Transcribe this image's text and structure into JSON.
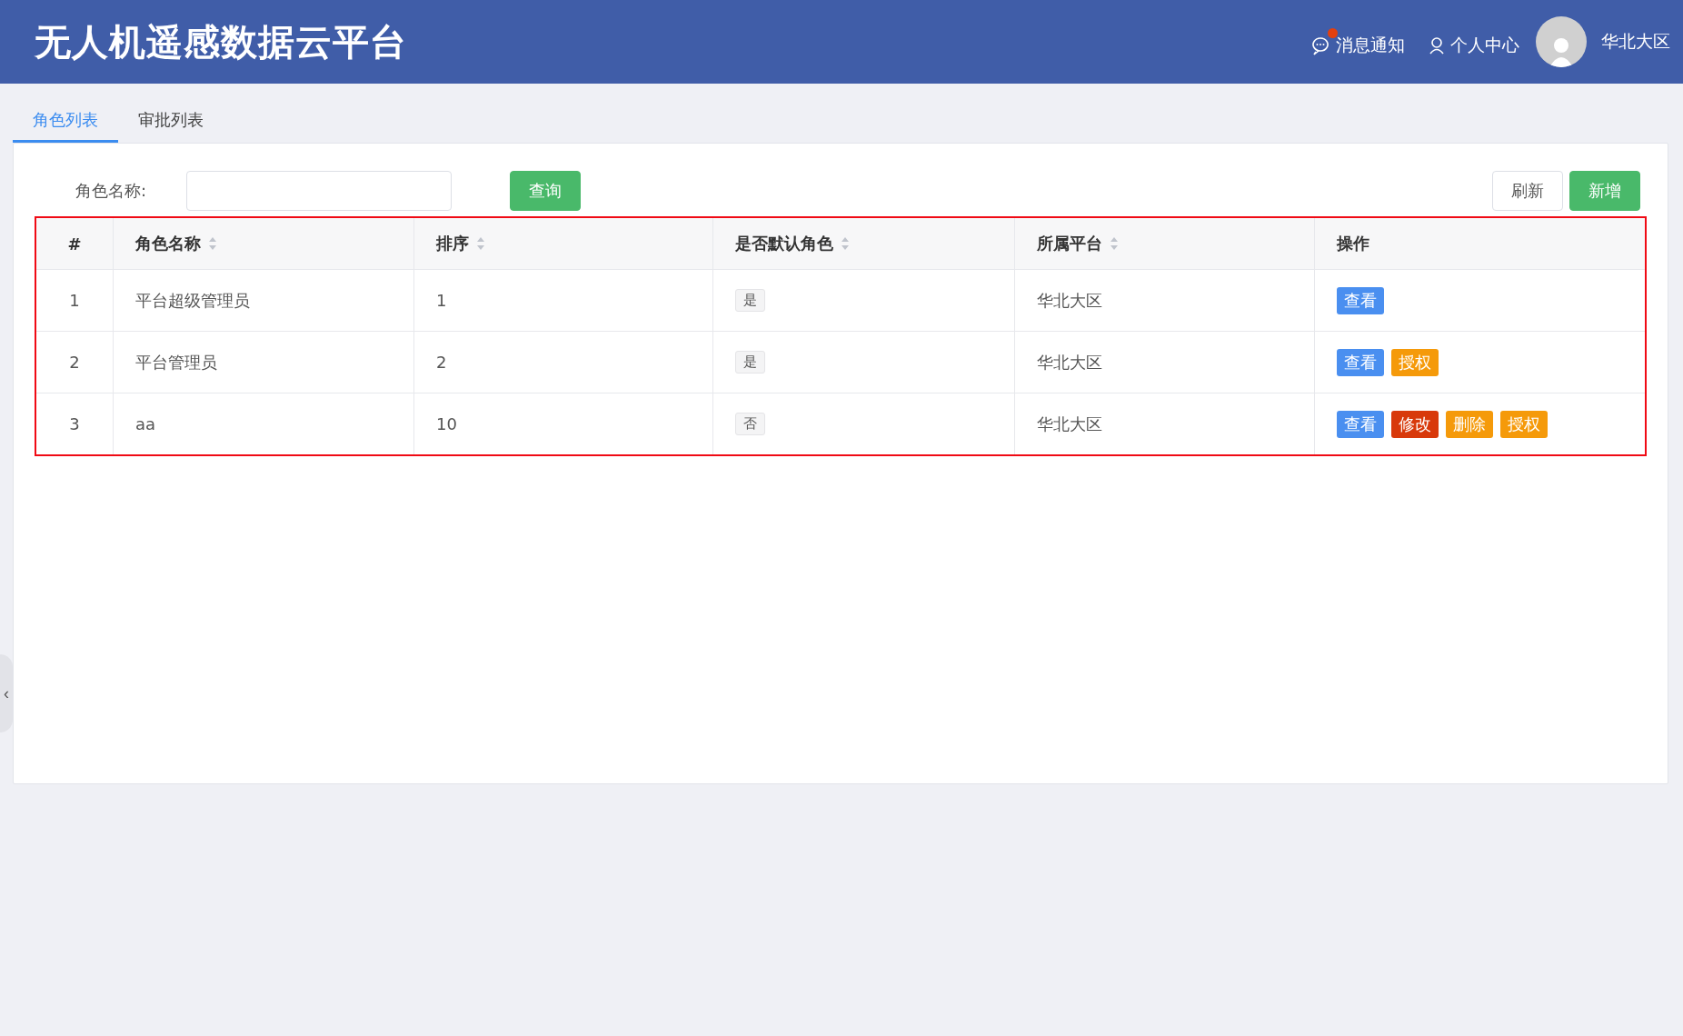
{
  "header": {
    "title": "无人机遥感数据云平台",
    "notifications": {
      "label": "消息通知",
      "unread": true
    },
    "profile": {
      "label": "个人中心"
    },
    "region": "华北大区"
  },
  "tabs": [
    {
      "label": "角色列表",
      "selected": true
    },
    {
      "label": "审批列表",
      "selected": false
    }
  ],
  "filter": {
    "label": "角色名称:",
    "search_button": "查询"
  },
  "toolbar": {
    "refresh": "刷新",
    "add": "新增"
  },
  "table": {
    "columns": [
      {
        "label": "#",
        "sortable": false
      },
      {
        "label": "角色名称",
        "sortable": true
      },
      {
        "label": "排序",
        "sortable": true
      },
      {
        "label": "是否默认角色",
        "sortable": true
      },
      {
        "label": "所属平台",
        "sortable": true
      },
      {
        "label": "操作",
        "sortable": false
      }
    ],
    "rows": [
      {
        "index": "1",
        "name": "平台超级管理员",
        "order": "1",
        "default": "是",
        "platform": "华北大区",
        "actions": [
          {
            "kind": "view",
            "label": "查看"
          }
        ]
      },
      {
        "index": "2",
        "name": "平台管理员",
        "order": "2",
        "default": "是",
        "platform": "华北大区",
        "actions": [
          {
            "kind": "view",
            "label": "查看"
          },
          {
            "kind": "grant",
            "label": "授权"
          }
        ]
      },
      {
        "index": "3",
        "name": "aa",
        "order": "10",
        "default": "否",
        "platform": "华北大区",
        "actions": [
          {
            "kind": "view",
            "label": "查看"
          },
          {
            "kind": "edit",
            "label": "修改"
          },
          {
            "kind": "delete",
            "label": "删除"
          },
          {
            "kind": "grant",
            "label": "授权"
          }
        ]
      }
    ]
  },
  "side_handle": "‹"
}
